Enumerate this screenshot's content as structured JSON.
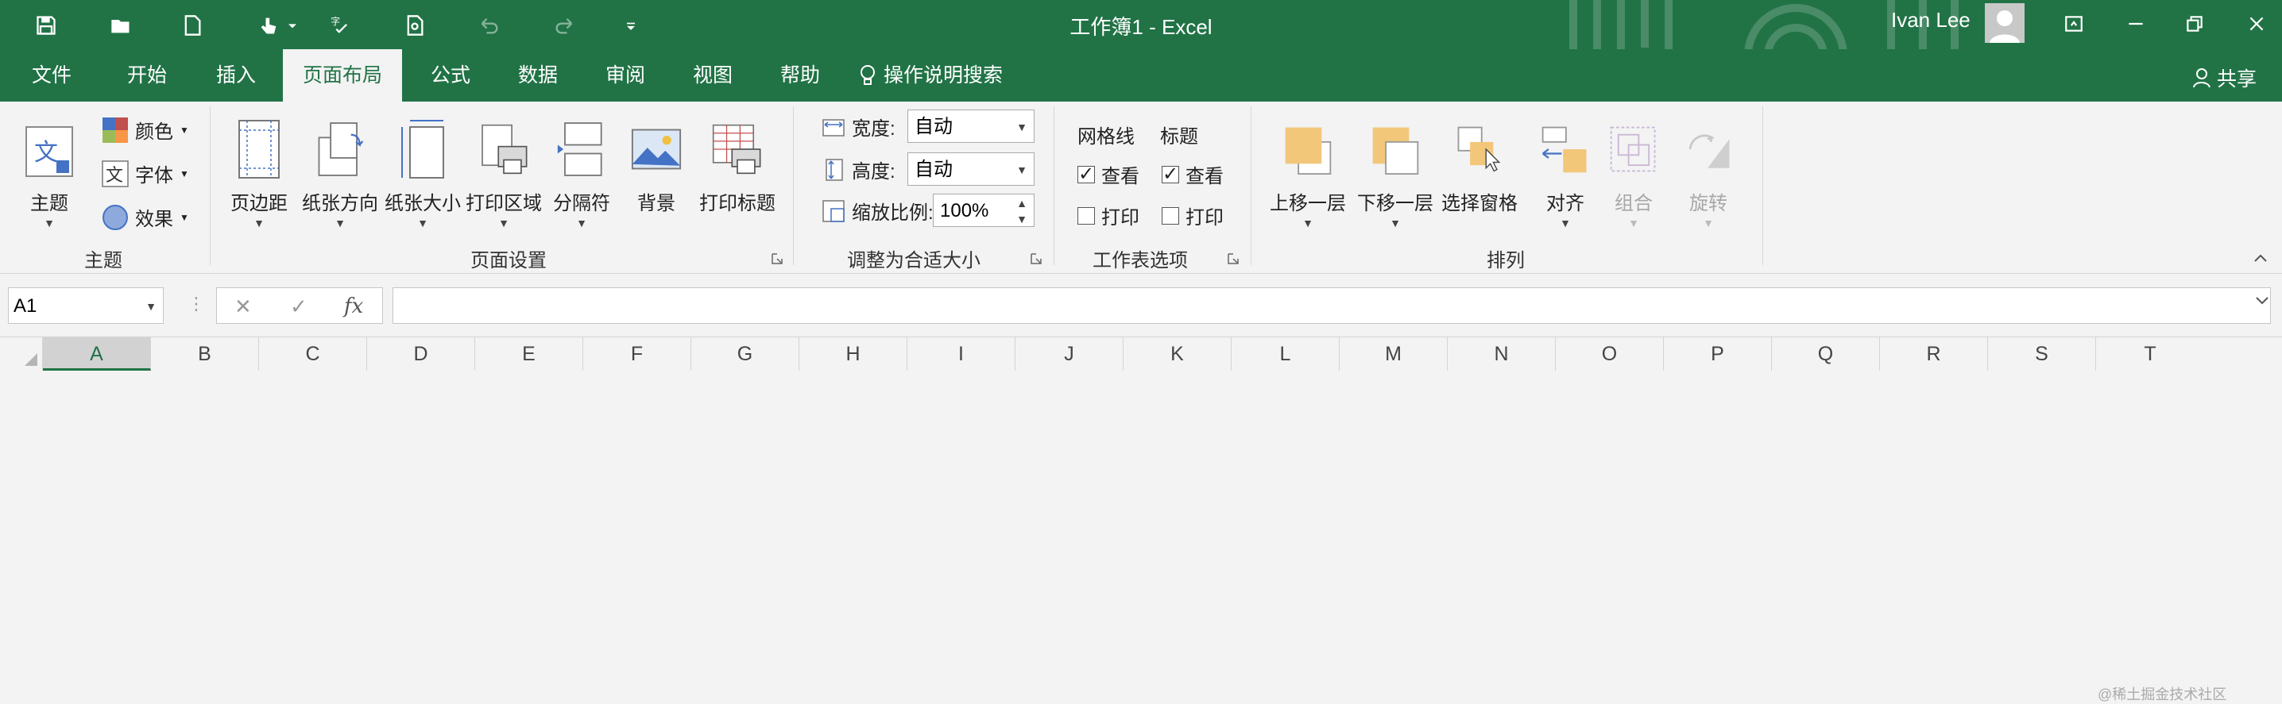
{
  "window": {
    "title": "工作簿1 - Excel",
    "user": "Ivan Lee"
  },
  "tabs": [
    "文件",
    "开始",
    "插入",
    "页面布局",
    "公式",
    "数据",
    "审阅",
    "视图",
    "帮助",
    "操作说明搜索"
  ],
  "share_label": "共享",
  "ribbon": {
    "themes": {
      "theme": "主题",
      "colors": "颜色",
      "fonts": "字体",
      "effects": "效果",
      "group": "主题"
    },
    "page_setup": {
      "margins": "页边距",
      "orientation": "纸张方向",
      "size": "纸张大小",
      "print_area": "打印区域",
      "breaks": "分隔符",
      "background": "背景",
      "print_titles": "打印标题",
      "group": "页面设置"
    },
    "scale": {
      "width_label": "宽度:",
      "width_value": "自动",
      "height_label": "高度:",
      "height_value": "自动",
      "scale_label": "缩放比例:",
      "scale_value": "100%",
      "group": "调整为合适大小"
    },
    "sheet_options": {
      "gridlines": "网格线",
      "headings": "标题",
      "view": "查看",
      "print": "打印",
      "group": "工作表选项"
    },
    "arrange": {
      "bring_forward": "上移一层",
      "send_backward": "下移一层",
      "selection_pane": "选择窗格",
      "align": "对齐",
      "group_btn": "组合",
      "rotate": "旋转",
      "group": "排列"
    }
  },
  "formula_bar": {
    "name_box": "A1",
    "fx": "fx",
    "cancel": "✕",
    "enter": "✓"
  },
  "columns": [
    "A",
    "B",
    "C",
    "D",
    "E",
    "F",
    "G",
    "H",
    "I",
    "J",
    "K",
    "L",
    "M",
    "N",
    "O",
    "P",
    "Q",
    "R",
    "S",
    "T"
  ],
  "watermark": "@稀土掘金技术社区",
  "colors": {
    "accent": "#217346"
  }
}
